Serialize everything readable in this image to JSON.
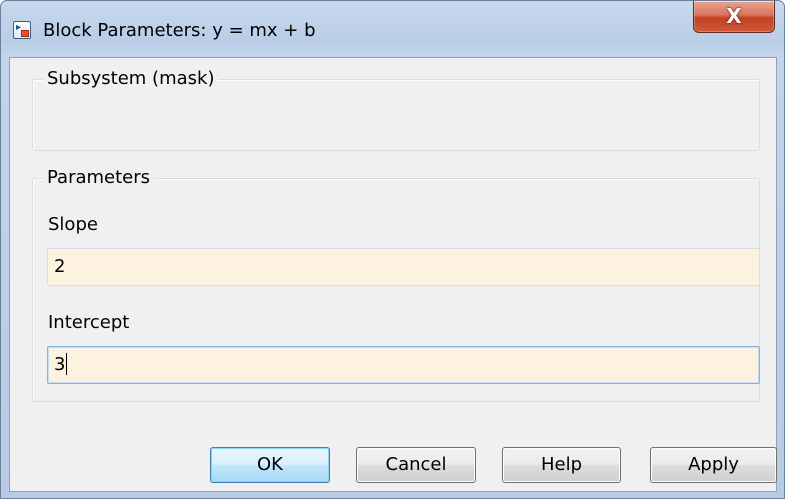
{
  "window": {
    "title": "Block Parameters: y = mx + b",
    "close_glyph": "X",
    "icon": "simulink-block-icon"
  },
  "subsystem": {
    "legend": "Subsystem (mask)"
  },
  "parameters": {
    "legend": "Parameters",
    "slope": {
      "label": "Slope",
      "value": "2"
    },
    "intercept": {
      "label": "Intercept",
      "value": "3"
    }
  },
  "buttons": {
    "ok": "OK",
    "cancel": "Cancel",
    "help": "Help",
    "apply": "Apply"
  },
  "colors": {
    "field_bg": "#fdf1df",
    "focus_border": "#7eb4ea",
    "close_red": "#c4401f"
  }
}
